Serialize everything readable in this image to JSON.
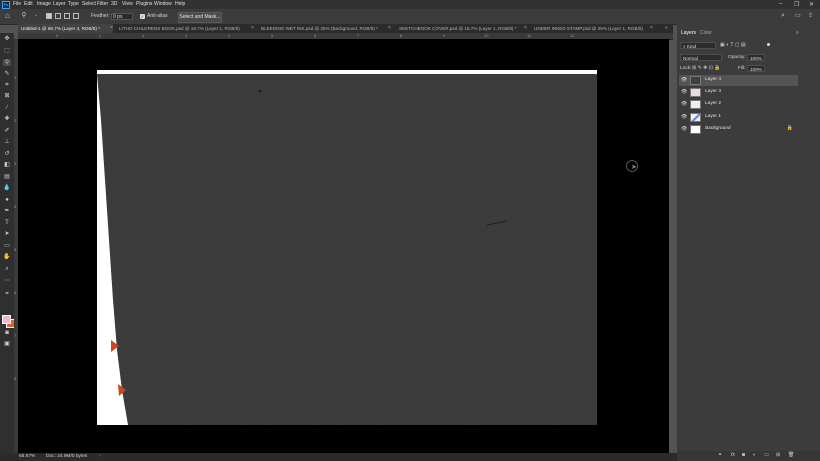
{
  "menu": [
    "File",
    "Edit",
    "Image",
    "Layer",
    "Type",
    "Select",
    "Filter",
    "3D",
    "View",
    "Plugins",
    "Window",
    "Help"
  ],
  "options": {
    "feather_label": "Feather:",
    "feather_value": "0 px",
    "antialias_label": "Anti-alias",
    "select_mask_label": "Select and Mask..."
  },
  "tabs": [
    {
      "label": "Untitled-1 @ 66.7% (Layer 4, RGB/8) *",
      "active": true
    },
    {
      "label": "LITHO CHILDRENS BOOK.psd @ 16.7% (Layer 1, RGB/8)",
      "active": false
    },
    {
      "label": "BLEEDING WET INK.psd @ 25% (Background, RGB/8) *",
      "active": false
    },
    {
      "label": "SKETCHBOOK COVER.psd @ 16.7% (Layer 1, RGB/8) *",
      "active": false
    },
    {
      "label": "UNDER INKED STAMP.psd @ 25% (Layer 1, RGB/8)",
      "active": false
    }
  ],
  "ruler_h": [
    "0",
    "1",
    "2",
    "3",
    "4",
    "5",
    "6",
    "7",
    "8",
    "9",
    "10",
    "11",
    "12"
  ],
  "ruler_v": [
    "1",
    "2",
    "3",
    "4",
    "5",
    "6",
    "7",
    "8"
  ],
  "panel": {
    "tabs": [
      "Layers",
      "Color"
    ],
    "kind_label": "Kind",
    "blend_mode": "Normal",
    "opacity_label": "Opacity:",
    "opacity_value": "100%",
    "lock_label": "Lock:",
    "fill_label": "Fill:",
    "fill_value": "100%",
    "layers": [
      {
        "name": "Layer 4",
        "selected": true
      },
      {
        "name": "Layer 3",
        "selected": false
      },
      {
        "name": "Layer 2",
        "selected": false
      },
      {
        "name": "Layer 1",
        "selected": false
      },
      {
        "name": "Background",
        "selected": false
      }
    ]
  },
  "status": {
    "zoom": "66.67%",
    "doc": "Doc: 24.9M/0 bytes"
  },
  "colors": {
    "foreground": "#f3b6cf",
    "background": "#d9652a",
    "accent": "#31a8ff",
    "triangle": "#c84a1f"
  }
}
